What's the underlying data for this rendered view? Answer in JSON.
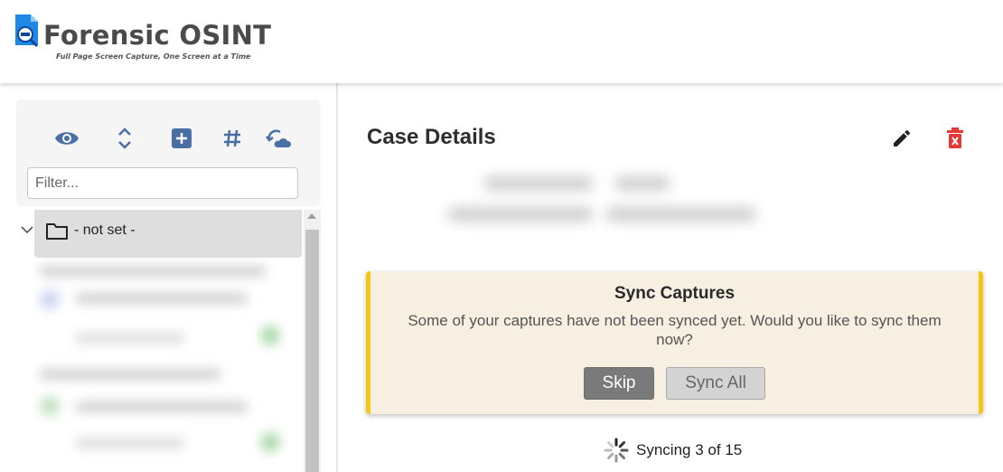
{
  "header": {
    "logo_title": "Forensic OSINT",
    "logo_tagline": "Full Page Screen Capture, One Screen at a Time",
    "logo_mark_icon": "forensic-osint-logo-icon"
  },
  "sidebar": {
    "toolbar_icons": [
      "eye-icon",
      "expand-collapse-icon",
      "add-square-icon",
      "hashtag-icon",
      "cloud-sync-icon"
    ],
    "filter": {
      "placeholder": "Filter...",
      "value": ""
    },
    "tree": {
      "root_label": "- not set -",
      "root_icon": "folder-icon",
      "expand_icon": "chevron-down-icon"
    }
  },
  "main": {
    "title": "Case Details",
    "actions": [
      "edit-pencil-icon",
      "delete-trash-icon"
    ],
    "sync_dialog": {
      "title": "Sync Captures",
      "message": "Some of your captures have not been synced yet. Would you like to sync them now?",
      "skip_label": "Skip",
      "sync_all_label": "Sync All"
    },
    "status": {
      "text": "Syncing 3 of 15",
      "current": 3,
      "total": 15
    }
  },
  "colors": {
    "accent_blue": "#4a6fa5",
    "danger_red": "#e53935",
    "dialog_bg": "#f6efe2",
    "dialog_border": "#f5c518",
    "skip_bg": "#7a7a7a",
    "sync_all_bg": "#d3d3d3"
  }
}
